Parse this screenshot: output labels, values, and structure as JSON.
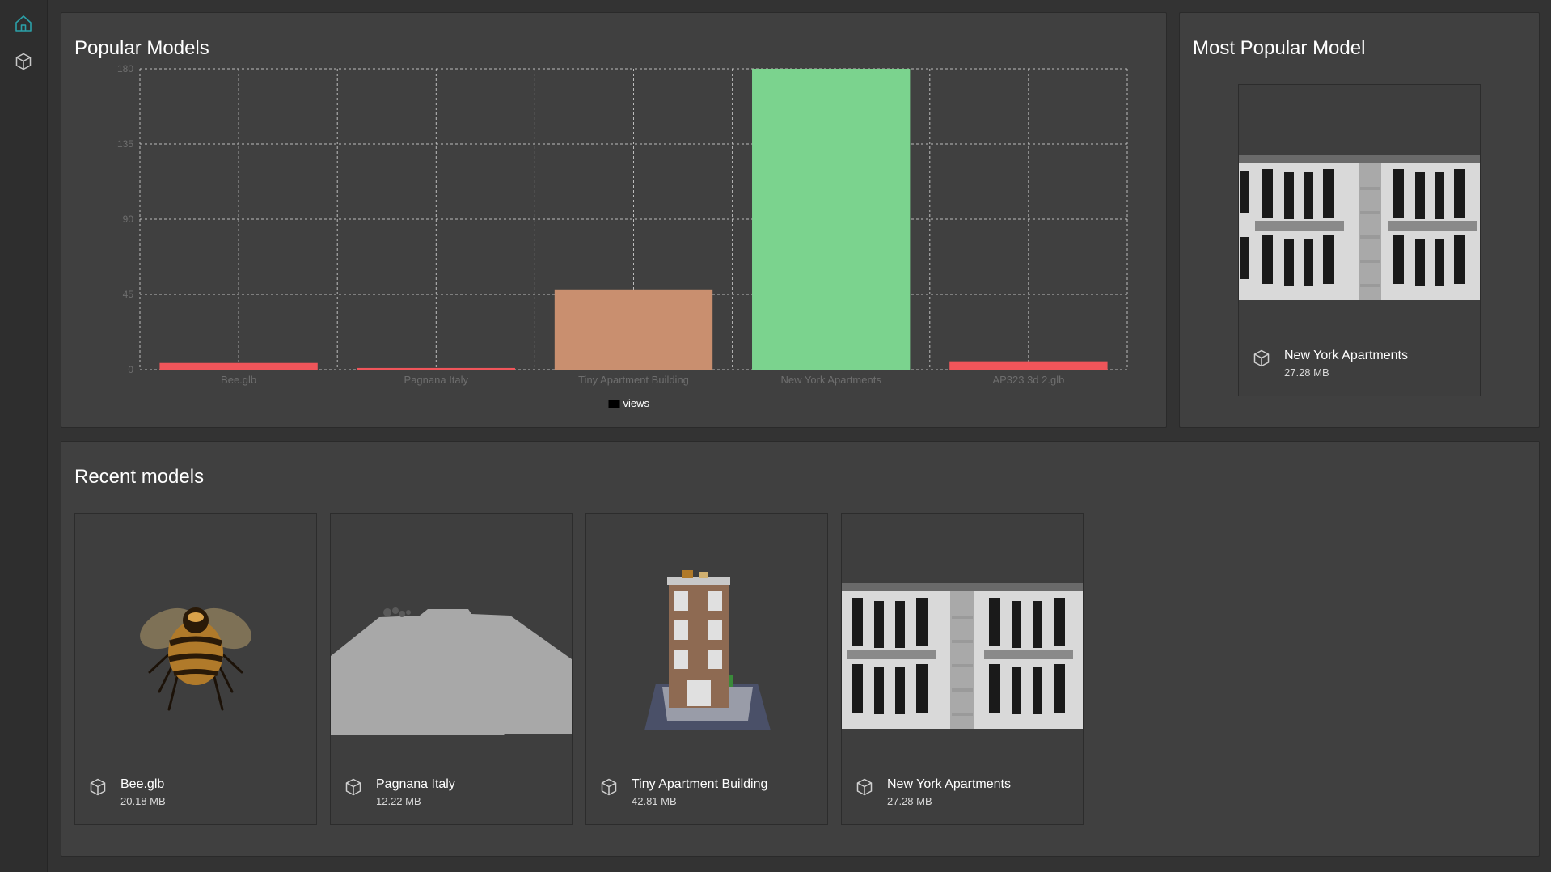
{
  "sidebar": {
    "items": [
      {
        "icon": "home-icon",
        "active": true
      },
      {
        "icon": "cube-icon",
        "active": false
      }
    ],
    "accent_color": "#2ba0a8"
  },
  "popular_models": {
    "title": "Popular Models"
  },
  "chart_data": {
    "type": "bar",
    "title": "",
    "xlabel": "",
    "ylabel": "",
    "categories": [
      "Bee.glb",
      "Pagnana Italy",
      "Tiny Apartment Building",
      "New York Apartments",
      "AP323 3d 2.glb"
    ],
    "series": [
      {
        "name": "views",
        "values": [
          4,
          1,
          48,
          180,
          5
        ],
        "colors": [
          "#f0555a",
          "#f0555a",
          "#c98f6f",
          "#7bd38e",
          "#f0555a"
        ]
      }
    ],
    "ylim": [
      0,
      180
    ],
    "yticks": [
      0,
      45,
      90,
      135,
      180
    ],
    "grid": true,
    "legend": "bottom-center",
    "legend_swatch_color": "#000000"
  },
  "most_popular": {
    "title": "Most Popular Model",
    "card": {
      "name": "New York Apartments",
      "size": "27.28 MB",
      "thumbnail": "new-york-apartments"
    }
  },
  "recent_models": {
    "title": "Recent models",
    "cards": [
      {
        "name": "Bee.glb",
        "size": "20.18 MB",
        "thumbnail": "bee"
      },
      {
        "name": "Pagnana Italy",
        "size": "12.22 MB",
        "thumbnail": "pagnana-italy"
      },
      {
        "name": "Tiny Apartment Building",
        "size": "42.81 MB",
        "thumbnail": "tiny-apartment-building"
      },
      {
        "name": "New York Apartments",
        "size": "27.28 MB",
        "thumbnail": "new-york-apartments"
      }
    ]
  }
}
